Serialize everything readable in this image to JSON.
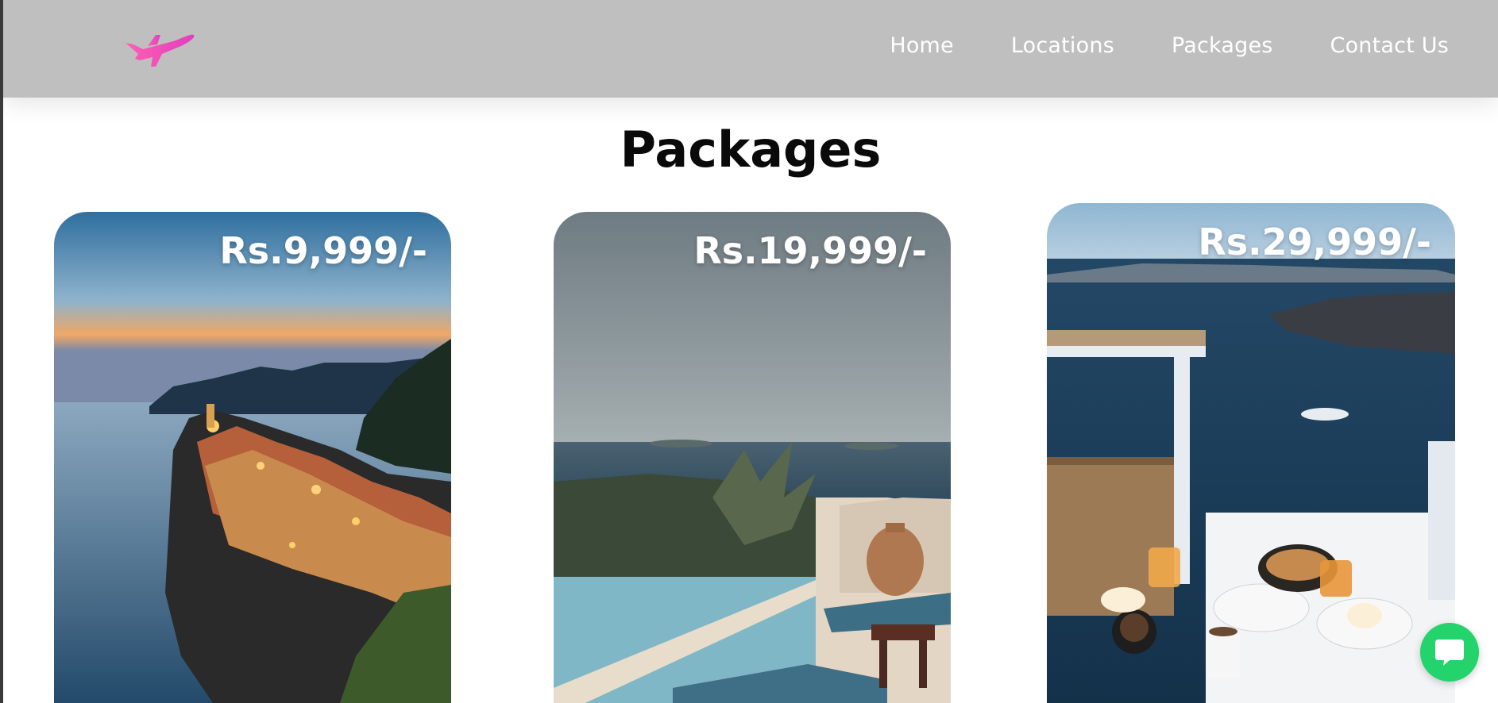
{
  "nav": {
    "logo_icon": "airplane-icon",
    "links": [
      "Home",
      "Locations",
      "Packages",
      "Contact Us"
    ]
  },
  "packages": {
    "title": "Packages",
    "cards": [
      {
        "price": "Rs.9,999/-",
        "image": "coastal-village-at-dusk"
      },
      {
        "price": "Rs.19,999/-",
        "image": "infinity-pool-with-sun-loungers"
      },
      {
        "price": "Rs.29,999/-",
        "image": "breakfast-table-overlooking-sea"
      }
    ]
  },
  "chat": {
    "icon": "chat-bubble-icon"
  },
  "colors": {
    "navbar_bg": "#bfbfbf",
    "logo_gradient": [
      "#ff5fb0",
      "#e040c0"
    ],
    "chat_button": "#23d36b",
    "title_text": "#0a0a0a"
  }
}
